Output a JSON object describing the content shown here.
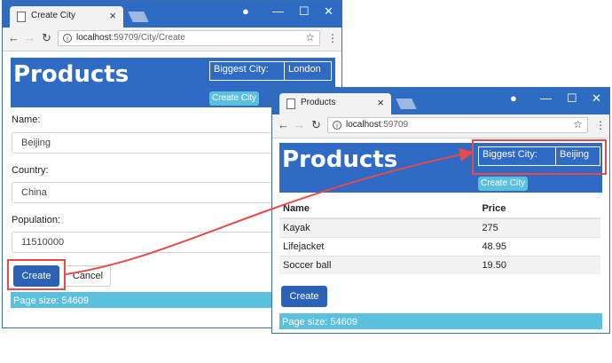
{
  "window1": {
    "tab_title": "Create City",
    "url_host": "localhost",
    "url_rest": ":59709/City/Create",
    "brand": "Products",
    "biggest_city_label": "Biggest City:",
    "biggest_city_value": "London",
    "create_city_label": "Create City",
    "form": {
      "name_label": "Name:",
      "name_value": "Beijing",
      "country_label": "Country:",
      "country_value": "China",
      "population_label": "Population:",
      "population_value": "11510000"
    },
    "create_label": "Create",
    "cancel_label": "Cancel",
    "page_size": "Page size: 54609"
  },
  "window2": {
    "tab_title": "Products",
    "url_host": "localhost",
    "url_rest": ":59709",
    "brand": "Products",
    "biggest_city_label": "Biggest City:",
    "biggest_city_value": "Beijing",
    "create_city_label": "Create City",
    "table": {
      "headers": [
        "Name",
        "Price"
      ],
      "rows": [
        [
          "Kayak",
          "275"
        ],
        [
          "Lifejacket",
          "48.95"
        ],
        [
          "Soccer ball",
          "19.50"
        ]
      ]
    },
    "create_label": "Create",
    "page_size": "Page size: 54609"
  },
  "colors": {
    "titlebar": "#2e6bc2",
    "header": "#2f6ac4",
    "info": "#5bc0de",
    "primary": "#2b62b8",
    "highlight": "#e54b4b"
  },
  "icons": [
    "page-icon",
    "close-icon",
    "minimize-icon",
    "maximize-icon",
    "profile-icon",
    "back-icon",
    "forward-icon",
    "reload-icon",
    "info-icon",
    "star-icon",
    "menu-icon"
  ]
}
